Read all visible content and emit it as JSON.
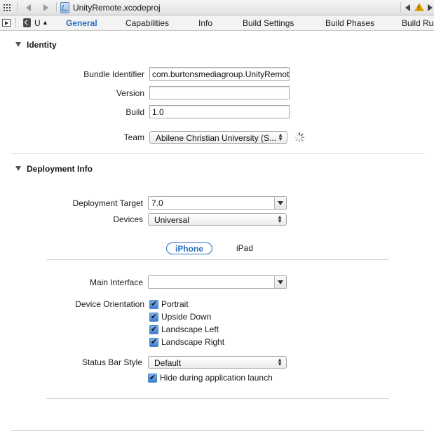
{
  "jumpbar": {
    "file_name": "UnityRemote.xcodeproj"
  },
  "tabbar": {
    "target_label": "U",
    "tabs": [
      {
        "label": "General",
        "active": true
      },
      {
        "label": "Capabilities",
        "active": false
      },
      {
        "label": "Info",
        "active": false
      },
      {
        "label": "Build Settings",
        "active": false
      },
      {
        "label": "Build Phases",
        "active": false
      },
      {
        "label": "Build Rul",
        "active": false
      }
    ]
  },
  "identity": {
    "title": "Identity",
    "bundle_identifier_label": "Bundle Identifier",
    "bundle_identifier_value": "com.burtonsmediagroup.UnityRemote",
    "version_label": "Version",
    "version_value": "",
    "build_label": "Build",
    "build_value": "1.0",
    "team_label": "Team",
    "team_value": "Abilene Christian University (S..."
  },
  "deployment": {
    "title": "Deployment Info",
    "target_label": "Deployment Target",
    "target_value": "7.0",
    "devices_label": "Devices",
    "devices_value": "Universal",
    "segments": {
      "iphone": "iPhone",
      "ipad": "iPad"
    },
    "main_interface_label": "Main Interface",
    "main_interface_value": "",
    "orientation_label": "Device Orientation",
    "orientations": [
      {
        "label": "Portrait",
        "checked": true
      },
      {
        "label": "Upside Down",
        "checked": true
      },
      {
        "label": "Landscape Left",
        "checked": true
      },
      {
        "label": "Landscape Right",
        "checked": true
      }
    ],
    "status_bar_label": "Status Bar Style",
    "status_bar_value": "Default",
    "hide_status_label": "Hide during application launch",
    "hide_status_checked": true
  },
  "colors": {
    "accent": "#2c6fc1",
    "warning": "#e8a000"
  }
}
